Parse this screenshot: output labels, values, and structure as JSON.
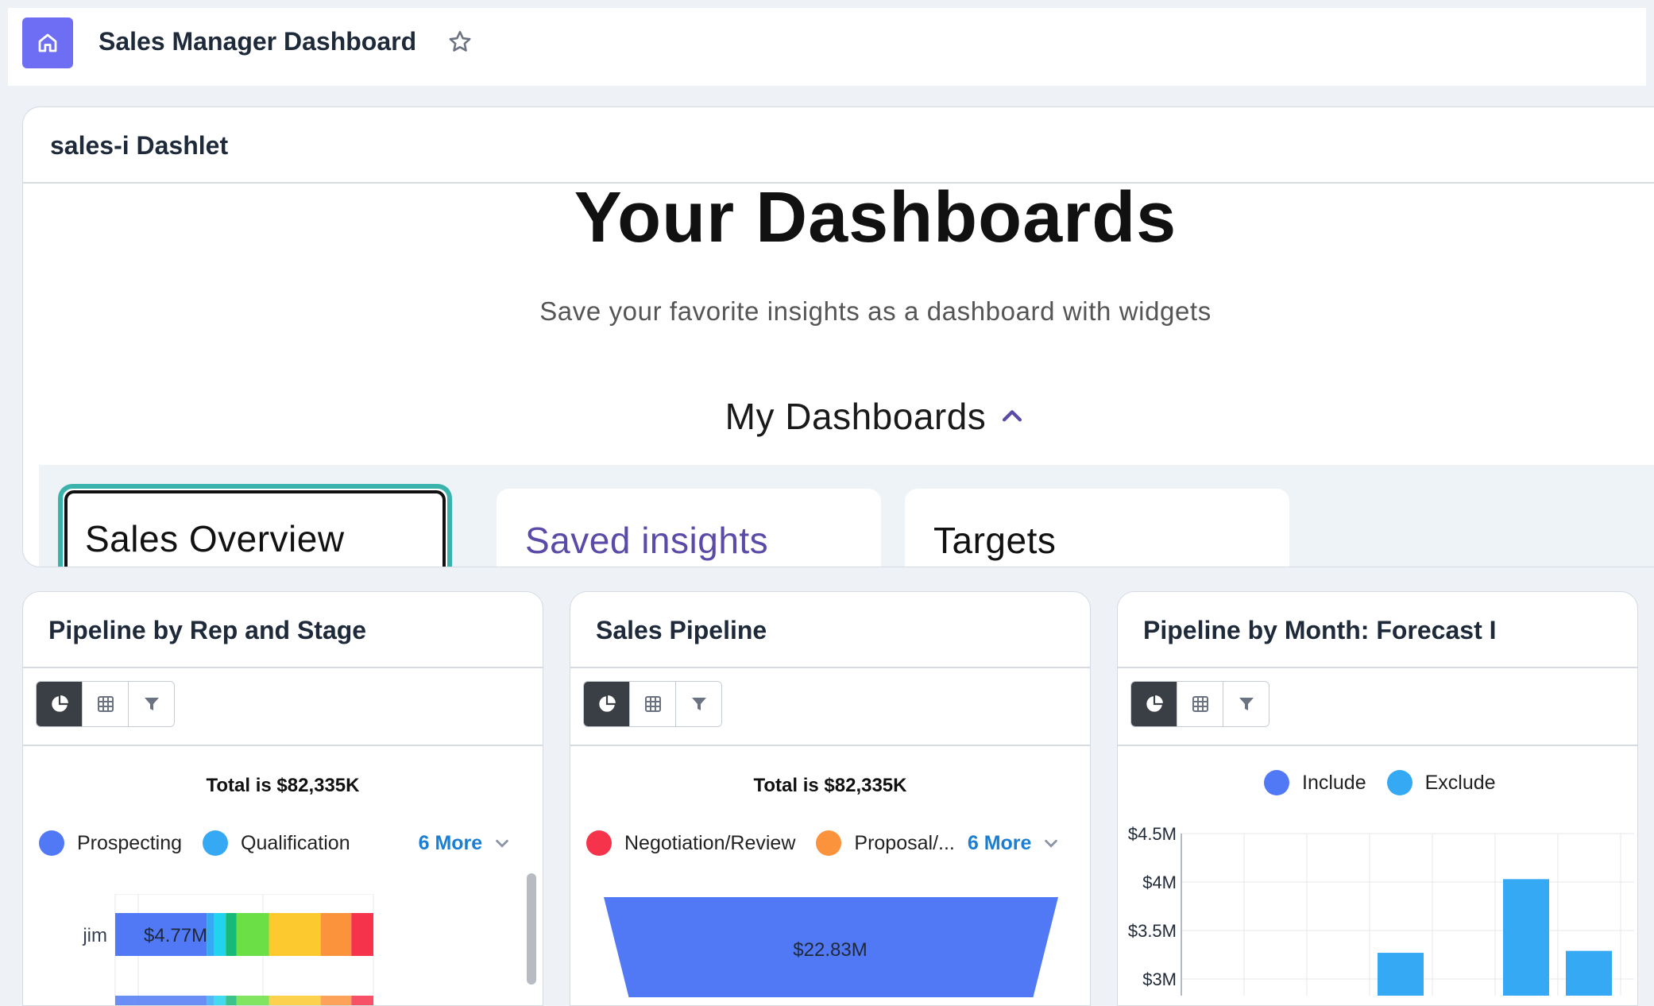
{
  "header": {
    "title": "Sales Manager Dashboard",
    "home_icon": "home-icon",
    "favorite_icon": "star-outline-icon"
  },
  "dashlet": {
    "title": "sales-i Dashlet",
    "hero_title": "Your Dashboards",
    "hero_subtitle": "Save your favorite insights as a dashboard with widgets",
    "section_label": "My Dashboards",
    "tabs": [
      {
        "label": "Sales Overview",
        "active": true
      },
      {
        "label": "Saved insights",
        "active": false
      },
      {
        "label": "Targets",
        "active": false
      }
    ]
  },
  "widgets": [
    {
      "title": "Pipeline by Rep and Stage",
      "toolbar": [
        "chart-icon",
        "table-icon",
        "filter-icon"
      ],
      "total": "Total is $82,335K",
      "legend": [
        {
          "label": "Prospecting",
          "color": "#5179f5"
        },
        {
          "label": "Qualification",
          "color": "#36a9f5"
        }
      ],
      "more": "6 More",
      "rep_label": "jim",
      "rep_value": "$4.77M"
    },
    {
      "title": "Sales Pipeline",
      "toolbar": [
        "chart-icon",
        "table-icon",
        "filter-icon"
      ],
      "total": "Total is $82,335K",
      "legend": [
        {
          "label": "Negotiation/Review",
          "color": "#f5334b"
        },
        {
          "label": "Proposal/...",
          "color": "#fb923c"
        }
      ],
      "more": "6 More",
      "funnel_value": "$22.83M"
    },
    {
      "title": "Pipeline by Month: Forecast I",
      "toolbar": [
        "chart-icon",
        "table-icon",
        "filter-icon"
      ],
      "legend": [
        {
          "label": "Include",
          "color": "#5179f5"
        },
        {
          "label": "Exclude",
          "color": "#36a9f5"
        }
      ]
    }
  ],
  "chart_data": [
    {
      "type": "bar",
      "title": "Pipeline by Rep and Stage",
      "orientation": "horizontal-stacked",
      "categories": [
        "jim"
      ],
      "series": [
        {
          "name": "Prospecting",
          "color": "#5179f5",
          "values": [
            4.77
          ]
        },
        {
          "name": "Qualification",
          "color": "#36a9f5",
          "values": [
            0.4
          ]
        },
        {
          "color": "#22d3ee",
          "values": [
            0.6
          ]
        },
        {
          "color": "#17b978",
          "values": [
            0.55
          ]
        },
        {
          "color": "#6be046",
          "values": [
            1.7
          ]
        },
        {
          "color": "#fcc92e",
          "values": [
            2.7
          ]
        },
        {
          "color": "#fb923c",
          "values": [
            1.6
          ]
        },
        {
          "color": "#f5334b",
          "values": [
            1.15
          ]
        }
      ],
      "data_labels": [
        "$4.77M"
      ]
    },
    {
      "type": "bar",
      "title": "Sales Pipeline",
      "orientation": "funnel",
      "categories": [
        "Negotiation/Review"
      ],
      "values": [
        22.83
      ],
      "data_labels": [
        "$22.83M"
      ]
    },
    {
      "type": "bar",
      "title": "Pipeline by Month: Forecast I",
      "ylim": [
        3,
        4.5
      ],
      "yticks": [
        "$4.5M",
        "$4M",
        "$3.5M",
        "$3M"
      ],
      "series": [
        {
          "name": "Exclude",
          "color": "#36a9f5",
          "values": [
            3.27,
            4.03,
            3.29
          ]
        }
      ],
      "bar_slots": [
        3,
        5,
        6
      ]
    }
  ]
}
